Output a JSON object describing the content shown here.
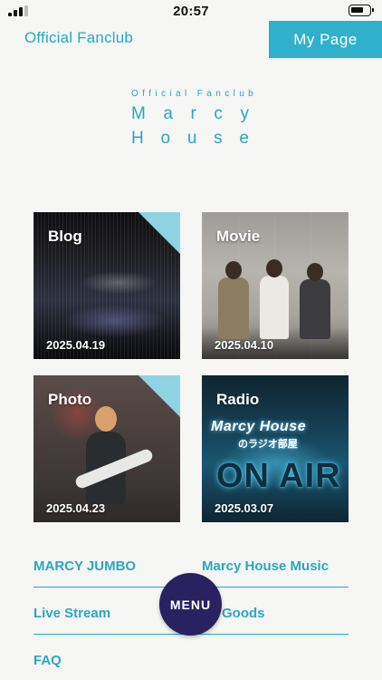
{
  "status_bar": {
    "time": "20:57",
    "signal_icon": "cellular-signal-icon",
    "battery_icon": "battery-icon"
  },
  "header": {
    "brand": "Official Fanclub",
    "my_page": "My Page"
  },
  "logo": {
    "small": "Official Fanclub",
    "line1": [
      "M",
      "a",
      "r",
      "c",
      "y"
    ],
    "line2": [
      "H",
      "o",
      "u",
      "s",
      "e"
    ]
  },
  "cards": {
    "blog": {
      "label": "Blog",
      "date": "2025.04.19"
    },
    "movie": {
      "label": "Movie",
      "date": "2025.04.10"
    },
    "photo": {
      "label": "Photo",
      "date": "2025.04.23"
    },
    "radio": {
      "label": "Radio",
      "date": "2025.03.07",
      "overlay_title": "Marcy House",
      "overlay_sub": "のラジオ部屋",
      "overlay_onair": "ON AIR"
    }
  },
  "links": {
    "row1": {
      "left": "MARCY JUMBO",
      "right": "Marcy House Music"
    },
    "row2": {
      "left": "Live Stream",
      "right": "Goods"
    },
    "row3": {
      "left": "FAQ"
    }
  },
  "menu_button": "MENU",
  "colors": {
    "accent": "#2aa7c0",
    "accent_button": "#30b0cc",
    "corner_tab": "#8fd3e2",
    "menu_button": "#2a2160",
    "background": "#f6f6f4"
  }
}
